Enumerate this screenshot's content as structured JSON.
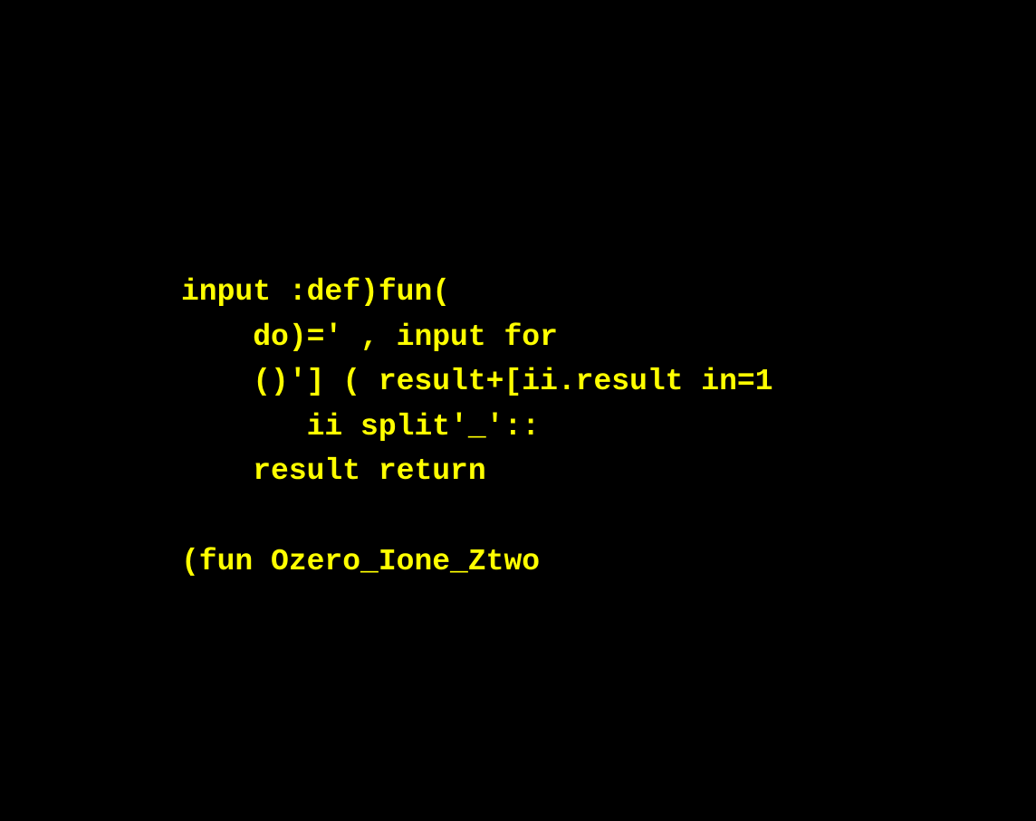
{
  "colors": {
    "background": "#000000",
    "text": "#FFFF00"
  },
  "code": {
    "lines": [
      "input :def)fun(",
      "    do)=' , input for",
      "    ()'] ( result+[ii.result in=1",
      "       ii split'_'::",
      "    result return",
      "",
      "(fun Ozero_Ione_Ztwo"
    ]
  }
}
